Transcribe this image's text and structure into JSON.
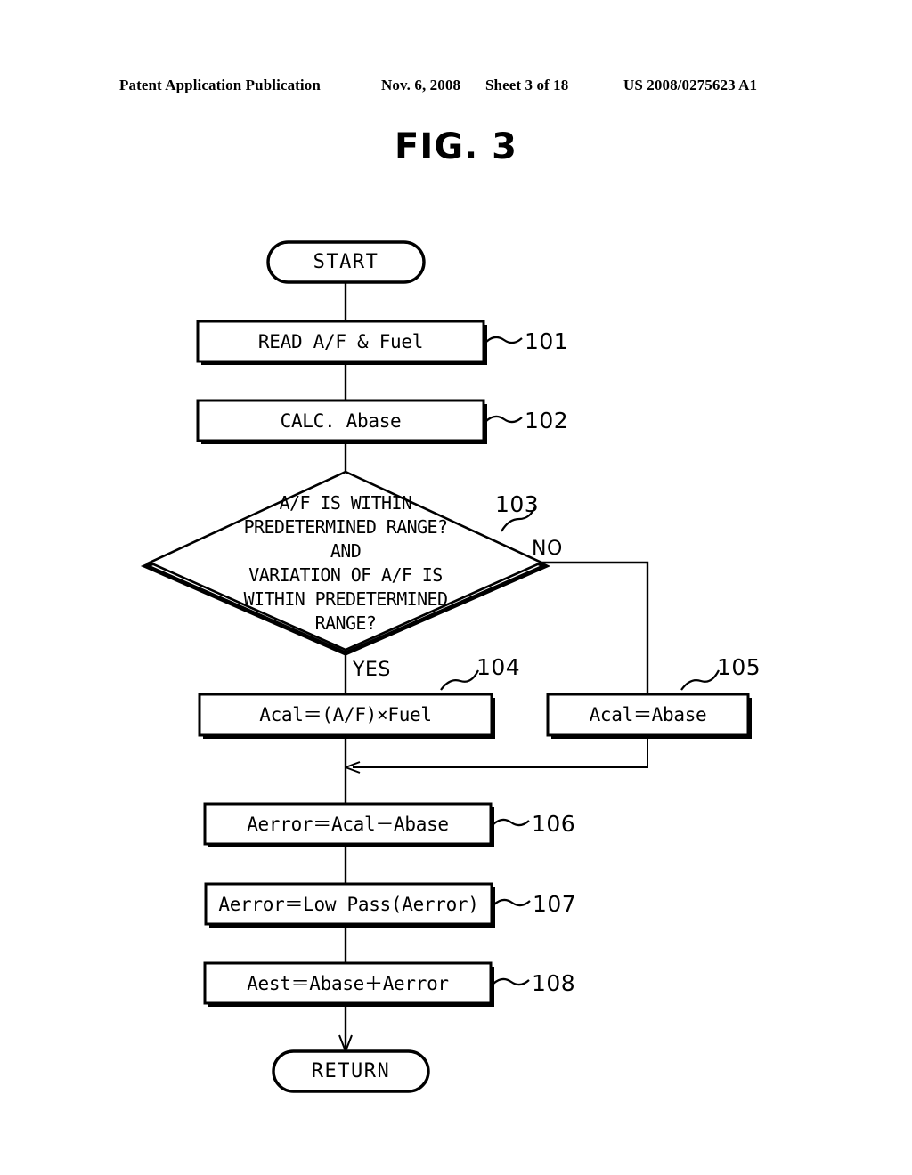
{
  "header": {
    "publication": "Patent Application Publication",
    "date": "Nov. 6, 2008",
    "sheet": "Sheet 3 of 18",
    "patent_number": "US 2008/0275623 A1"
  },
  "figure": {
    "title": "FIG. 3",
    "type": "flowchart",
    "nodes": [
      {
        "id": "start",
        "shape": "terminal",
        "label": "START",
        "ref": ""
      },
      {
        "id": "s101",
        "shape": "process",
        "label": "READ A/F & Fuel",
        "ref": "101"
      },
      {
        "id": "s102",
        "shape": "process",
        "label": "CALC. Abase",
        "ref": "102"
      },
      {
        "id": "s103",
        "shape": "decision",
        "label": "A/F IS WITHIN\nPREDETERMINED RANGE?\nAND\nVARIATION OF A/F IS\nWITHIN PREDETERMINED\nRANGE?",
        "ref": "103"
      },
      {
        "id": "s104",
        "shape": "process",
        "label": "Acal＝(A/F)×Fuel",
        "ref": "104"
      },
      {
        "id": "s105",
        "shape": "process",
        "label": "Acal＝Abase",
        "ref": "105"
      },
      {
        "id": "s106",
        "shape": "process",
        "label": "Aerror＝Acal－Abase",
        "ref": "106"
      },
      {
        "id": "s107",
        "shape": "process",
        "label": "Aerror＝Low Pass(Aerror)",
        "ref": "107"
      },
      {
        "id": "s108",
        "shape": "process",
        "label": "Aest＝Abase＋Aerror",
        "ref": "108"
      },
      {
        "id": "return",
        "shape": "terminal",
        "label": "RETURN",
        "ref": ""
      }
    ],
    "decision_lines": [
      "A/F IS WITHIN",
      "PREDETERMINED RANGE?",
      "AND",
      "VARIATION OF A/F IS",
      "WITHIN PREDETERMINED",
      "RANGE?"
    ],
    "branch_labels": {
      "yes": "YES",
      "no": "NO"
    },
    "ink_color": "#000000",
    "paper_color": "#ffffff"
  }
}
